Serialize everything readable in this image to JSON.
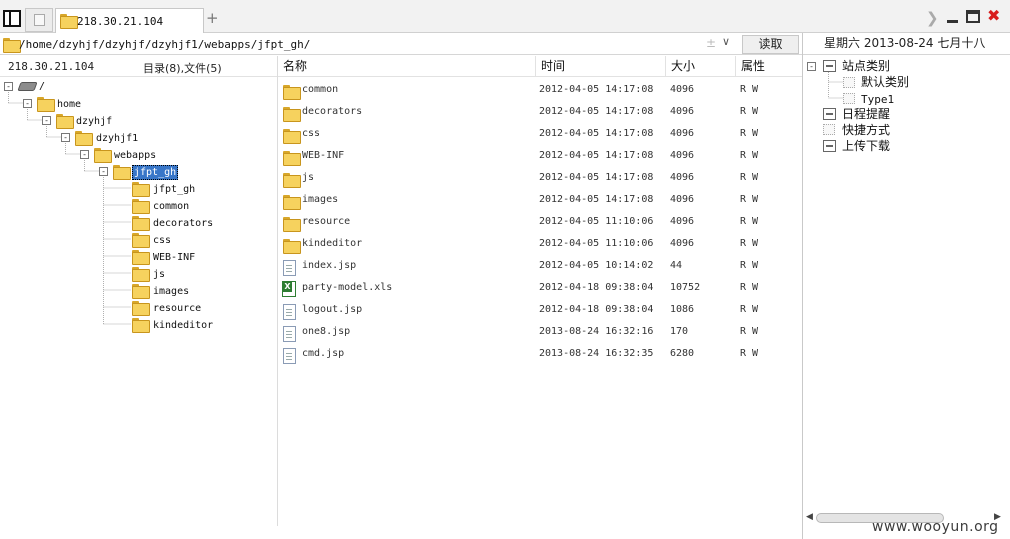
{
  "tab": {
    "label": "218.30.21.104"
  },
  "address": {
    "path": "/home/dzyhjf/dzyhjf/dzyhjf1/webapps/jfpt_gh/",
    "read_button": "读取"
  },
  "date": "星期六 2013-08-24 七月十八",
  "left": {
    "host": "218.30.21.104",
    "counts": "目录(8),文件(5)",
    "tree": {
      "root": "/",
      "home": "home",
      "dzyhjf": "dzyhjf",
      "dzyhjf1": "dzyhjf1",
      "webapps": "webapps",
      "selected": "jfpt_gh",
      "children": [
        "jfpt_gh",
        "common",
        "decorators",
        "css",
        "WEB-INF",
        "js",
        "images",
        "resource",
        "kindeditor"
      ]
    }
  },
  "columns": {
    "name": "名称",
    "time": "时间",
    "size": "大小",
    "attr": "属性"
  },
  "files": [
    {
      "type": "folder",
      "name": "common",
      "time": "2012-04-05 14:17:08",
      "size": "4096",
      "attr": "R W"
    },
    {
      "type": "folder",
      "name": "decorators",
      "time": "2012-04-05 14:17:08",
      "size": "4096",
      "attr": "R W"
    },
    {
      "type": "folder",
      "name": "css",
      "time": "2012-04-05 14:17:08",
      "size": "4096",
      "attr": "R W"
    },
    {
      "type": "folder",
      "name": "WEB-INF",
      "time": "2012-04-05 14:17:08",
      "size": "4096",
      "attr": "R W"
    },
    {
      "type": "folder",
      "name": "js",
      "time": "2012-04-05 14:17:08",
      "size": "4096",
      "attr": "R W"
    },
    {
      "type": "folder",
      "name": "images",
      "time": "2012-04-05 14:17:08",
      "size": "4096",
      "attr": "R W"
    },
    {
      "type": "folder",
      "name": "resource",
      "time": "2012-04-05 11:10:06",
      "size": "4096",
      "attr": "R W"
    },
    {
      "type": "folder",
      "name": "kindeditor",
      "time": "2012-04-05 11:10:06",
      "size": "4096",
      "attr": "R W"
    },
    {
      "type": "file",
      "name": "index.jsp",
      "time": "2012-04-05 10:14:02",
      "size": "44",
      "attr": "R W"
    },
    {
      "type": "xls",
      "name": "party-model.xls",
      "time": "2012-04-18 09:38:04",
      "size": "10752",
      "attr": "R W"
    },
    {
      "type": "file",
      "name": "logout.jsp",
      "time": "2012-04-18 09:38:04",
      "size": "1086",
      "attr": "R W"
    },
    {
      "type": "file",
      "name": "one8.jsp",
      "time": "2013-08-24 16:32:16",
      "size": "170",
      "attr": "R W"
    },
    {
      "type": "file",
      "name": "cmd.jsp",
      "time": "2013-08-24 16:32:35",
      "size": "6280",
      "attr": "R W"
    }
  ],
  "right": {
    "site_category": "站点类别",
    "default_category": "默认类别",
    "type1": "Type1",
    "schedule": "日程提醒",
    "shortcuts": "快捷方式",
    "upload_download": "上传下载"
  },
  "watermark": "www.wooyun.org"
}
